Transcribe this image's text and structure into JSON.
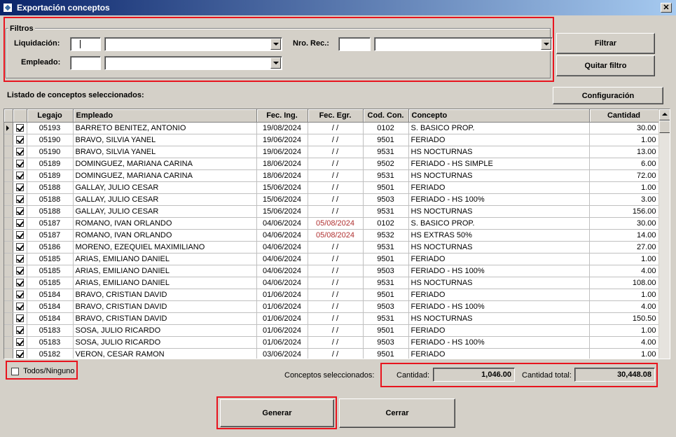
{
  "window": {
    "title": "Exportación conceptos",
    "close_glyph": "✕"
  },
  "filters": {
    "legend": "Filtros",
    "liquidacion_label": "Liquidación:",
    "empleado_label": "Empleado:",
    "nro_rec_label": "Nro. Rec.:",
    "liquidacion_code": "",
    "liquidacion_value": "",
    "empleado_code": "",
    "empleado_value": "",
    "nro_rec_code": "",
    "nro_rec_value": ""
  },
  "buttons": {
    "filtrar": "Filtrar",
    "quitar_filtro": "Quitar filtro",
    "configuracion": "Configuración",
    "generar": "Generar",
    "cerrar": "Cerrar"
  },
  "list_title": "Listado de conceptos seleccionados:",
  "grid": {
    "columns": [
      "Legajo",
      "Empleado",
      "Fec. Ing.",
      "Fec. Egr.",
      "Cod. Con.",
      "Concepto",
      "Cantidad"
    ],
    "rows": [
      {
        "checked": true,
        "legajo": "05193",
        "empleado": "BARRETO BENITEZ, ANTONIO",
        "fec_ing": "19/08/2024",
        "fec_egr": " / /",
        "cod": "0102",
        "concepto": "S. BASICO PROP.",
        "cantidad": "30.00",
        "egr_red": false
      },
      {
        "checked": true,
        "legajo": "05190",
        "empleado": "BRAVO, SILVIA YANEL",
        "fec_ing": "19/06/2024",
        "fec_egr": " / /",
        "cod": "9501",
        "concepto": "FERIADO",
        "cantidad": "1.00",
        "egr_red": false
      },
      {
        "checked": true,
        "legajo": "05190",
        "empleado": "BRAVO, SILVIA YANEL",
        "fec_ing": "19/06/2024",
        "fec_egr": " / /",
        "cod": "9531",
        "concepto": "HS NOCTURNAS",
        "cantidad": "13.00",
        "egr_red": false
      },
      {
        "checked": true,
        "legajo": "05189",
        "empleado": "DOMINGUEZ, MARIANA CARINA",
        "fec_ing": "18/06/2024",
        "fec_egr": " / /",
        "cod": "9502",
        "concepto": "FERIADO - HS SIMPLE",
        "cantidad": "6.00",
        "egr_red": false
      },
      {
        "checked": true,
        "legajo": "05189",
        "empleado": "DOMINGUEZ, MARIANA CARINA",
        "fec_ing": "18/06/2024",
        "fec_egr": " / /",
        "cod": "9531",
        "concepto": "HS NOCTURNAS",
        "cantidad": "72.00",
        "egr_red": false
      },
      {
        "checked": true,
        "legajo": "05188",
        "empleado": "GALLAY, JULIO CESAR",
        "fec_ing": "15/06/2024",
        "fec_egr": " / /",
        "cod": "9501",
        "concepto": "FERIADO",
        "cantidad": "1.00",
        "egr_red": false
      },
      {
        "checked": true,
        "legajo": "05188",
        "empleado": "GALLAY, JULIO CESAR",
        "fec_ing": "15/06/2024",
        "fec_egr": " / /",
        "cod": "9503",
        "concepto": "FERIADO - HS 100%",
        "cantidad": "3.00",
        "egr_red": false
      },
      {
        "checked": true,
        "legajo": "05188",
        "empleado": "GALLAY, JULIO CESAR",
        "fec_ing": "15/06/2024",
        "fec_egr": " / /",
        "cod": "9531",
        "concepto": "HS NOCTURNAS",
        "cantidad": "156.00",
        "egr_red": false
      },
      {
        "checked": true,
        "legajo": "05187",
        "empleado": "ROMANO, IVAN ORLANDO",
        "fec_ing": "04/06/2024",
        "fec_egr": "05/08/2024",
        "cod": "0102",
        "concepto": "S. BASICO PROP.",
        "cantidad": "30.00",
        "egr_red": true
      },
      {
        "checked": true,
        "legajo": "05187",
        "empleado": "ROMANO, IVAN ORLANDO",
        "fec_ing": "04/06/2024",
        "fec_egr": "05/08/2024",
        "cod": "9532",
        "concepto": "HS EXTRAS 50%",
        "cantidad": "14.00",
        "egr_red": true
      },
      {
        "checked": true,
        "legajo": "05186",
        "empleado": "MORENO, EZEQUIEL MAXIMILIANO",
        "fec_ing": "04/06/2024",
        "fec_egr": " / /",
        "cod": "9531",
        "concepto": "HS NOCTURNAS",
        "cantidad": "27.00",
        "egr_red": false
      },
      {
        "checked": true,
        "legajo": "05185",
        "empleado": "ARIAS, EMILIANO DANIEL",
        "fec_ing": "04/06/2024",
        "fec_egr": " / /",
        "cod": "9501",
        "concepto": "FERIADO",
        "cantidad": "1.00",
        "egr_red": false
      },
      {
        "checked": true,
        "legajo": "05185",
        "empleado": "ARIAS, EMILIANO DANIEL",
        "fec_ing": "04/06/2024",
        "fec_egr": " / /",
        "cod": "9503",
        "concepto": "FERIADO - HS 100%",
        "cantidad": "4.00",
        "egr_red": false
      },
      {
        "checked": true,
        "legajo": "05185",
        "empleado": "ARIAS, EMILIANO DANIEL",
        "fec_ing": "04/06/2024",
        "fec_egr": " / /",
        "cod": "9531",
        "concepto": "HS NOCTURNAS",
        "cantidad": "108.00",
        "egr_red": false
      },
      {
        "checked": true,
        "legajo": "05184",
        "empleado": "BRAVO, CRISTIAN DAVID",
        "fec_ing": "01/06/2024",
        "fec_egr": " / /",
        "cod": "9501",
        "concepto": "FERIADO",
        "cantidad": "1.00",
        "egr_red": false
      },
      {
        "checked": true,
        "legajo": "05184",
        "empleado": "BRAVO, CRISTIAN DAVID",
        "fec_ing": "01/06/2024",
        "fec_egr": " / /",
        "cod": "9503",
        "concepto": "FERIADO - HS 100%",
        "cantidad": "4.00",
        "egr_red": false
      },
      {
        "checked": true,
        "legajo": "05184",
        "empleado": "BRAVO, CRISTIAN DAVID",
        "fec_ing": "01/06/2024",
        "fec_egr": " / /",
        "cod": "9531",
        "concepto": "HS NOCTURNAS",
        "cantidad": "150.50",
        "egr_red": false
      },
      {
        "checked": true,
        "legajo": "05183",
        "empleado": "SOSA, JULIO RICARDO",
        "fec_ing": "01/06/2024",
        "fec_egr": " / /",
        "cod": "9501",
        "concepto": "FERIADO",
        "cantidad": "1.00",
        "egr_red": false
      },
      {
        "checked": true,
        "legajo": "05183",
        "empleado": "SOSA, JULIO RICARDO",
        "fec_ing": "01/06/2024",
        "fec_egr": " / /",
        "cod": "9503",
        "concepto": "FERIADO - HS 100%",
        "cantidad": "4.00",
        "egr_red": false
      },
      {
        "checked": true,
        "legajo": "05182",
        "empleado": "VERON, CESAR RAMON",
        "fec_ing": "03/06/2024",
        "fec_egr": " / /",
        "cod": "9501",
        "concepto": "FERIADO",
        "cantidad": "1.00",
        "egr_red": false
      }
    ]
  },
  "todos_ninguno": {
    "label": "Todos/Ninguno",
    "checked": false
  },
  "summary": {
    "label": "Conceptos seleccionados:",
    "cantidad_label": "Cantidad:",
    "cantidad_value": "1,046.00",
    "total_label": "Cantidad total:",
    "total_value": "30,448.08"
  },
  "colors": {
    "highlight_box": "#e8141e",
    "title_gradient_start": "#0a246a",
    "egreso_text": "#b03030"
  }
}
